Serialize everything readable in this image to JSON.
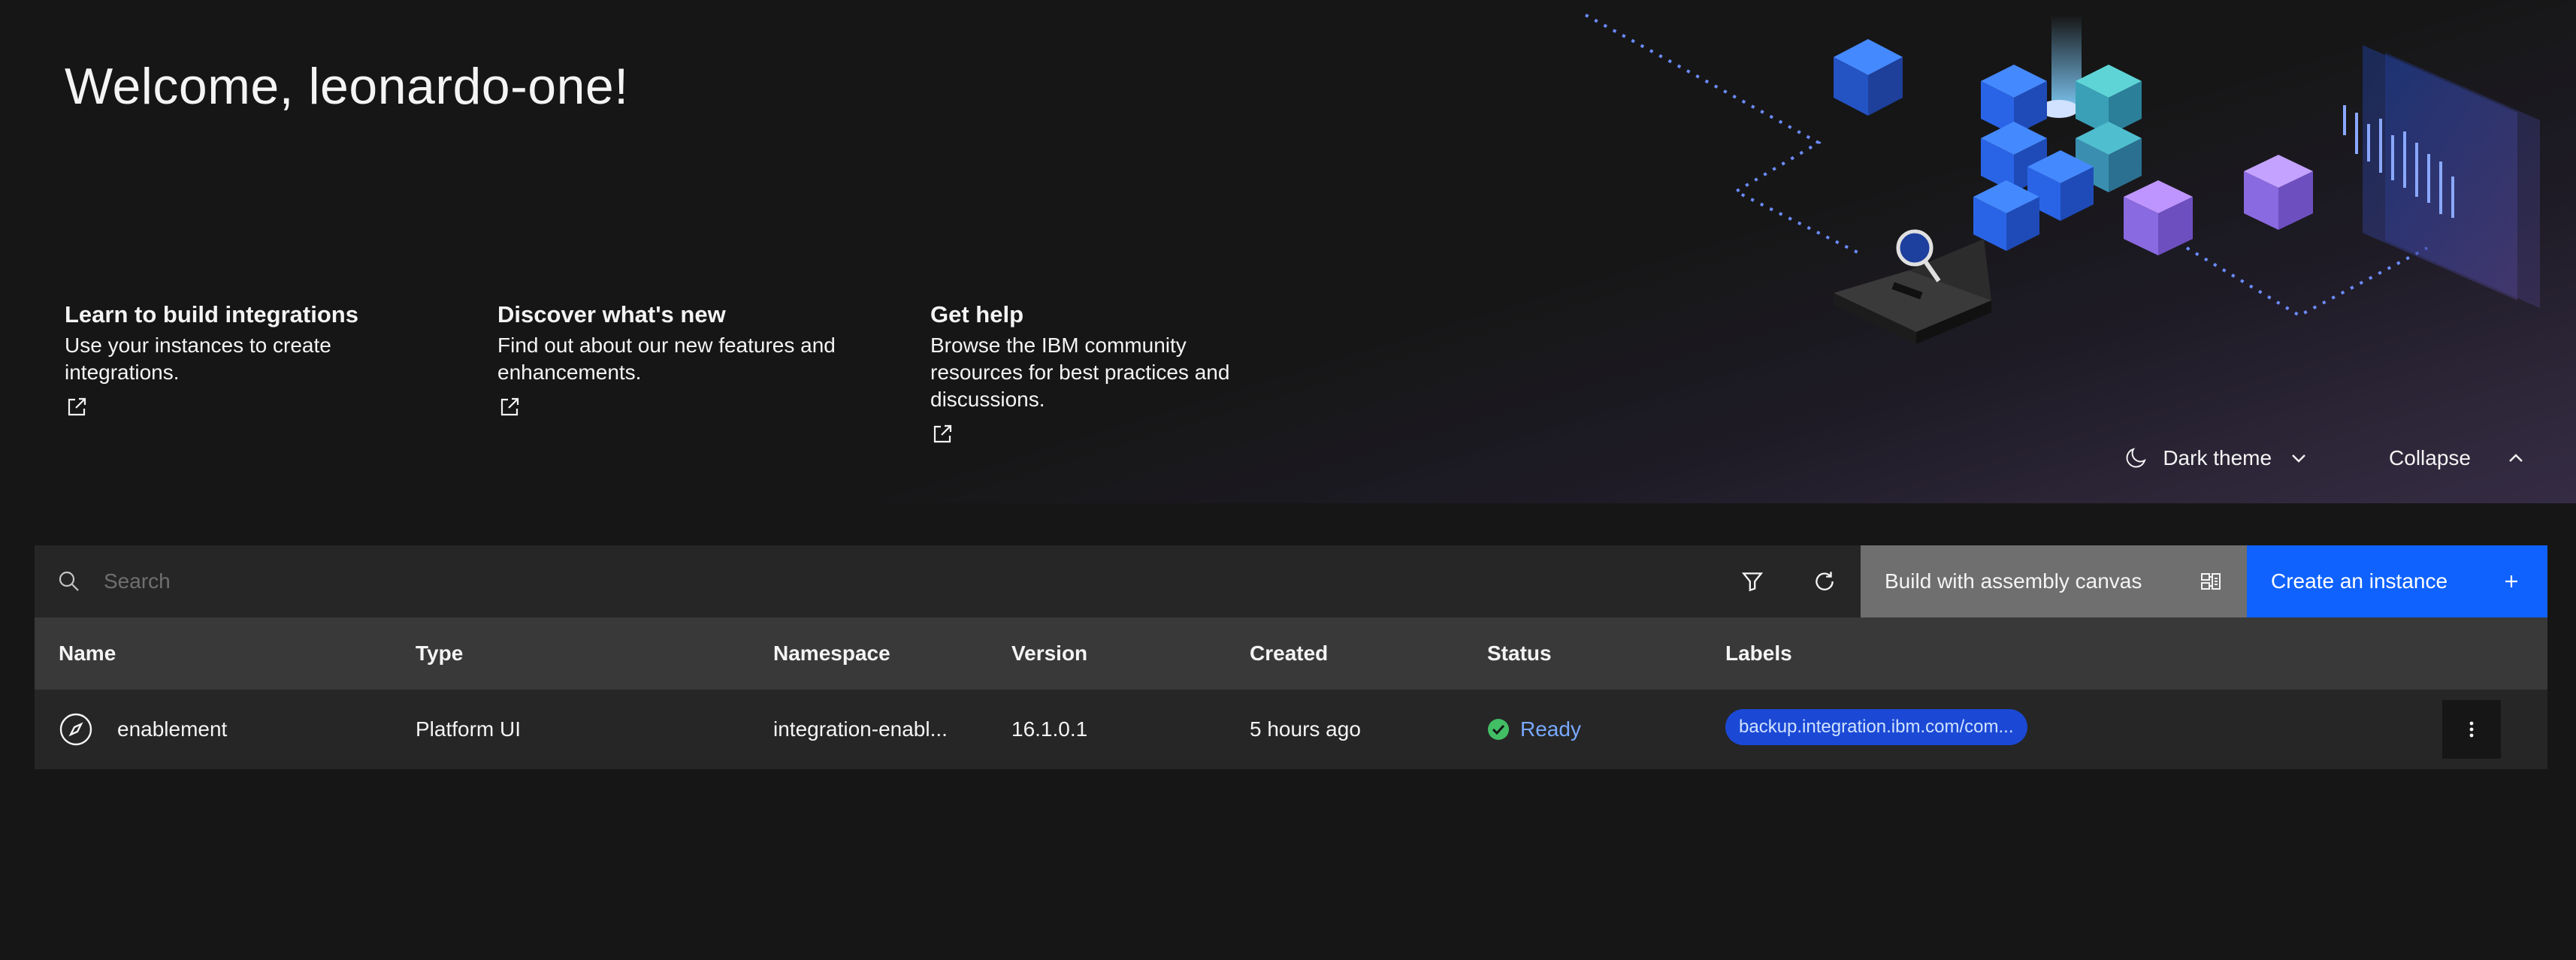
{
  "hero": {
    "welcome": "Welcome, leonardo-one!",
    "cards": [
      {
        "title": "Learn to build integrations",
        "description": "Use your instances to create integrations.",
        "link_icon": "launch-icon"
      },
      {
        "title": "Discover what's new",
        "description": "Find out about our new features and enhancements.",
        "link_icon": "launch-icon"
      },
      {
        "title": "Get help",
        "description": "Browse the IBM community resources for best practices and discussions.",
        "link_icon": "launch-icon"
      }
    ],
    "theme_label": "Dark theme",
    "collapse_label": "Collapse"
  },
  "toolbar": {
    "search_placeholder": "Search",
    "build_canvas_label": "Build with assembly canvas",
    "create_instance_label": "Create an instance"
  },
  "table": {
    "headers": [
      "Name",
      "Type",
      "Namespace",
      "Version",
      "Created",
      "Status",
      "Labels"
    ],
    "rows": [
      {
        "name": "enablement",
        "type": "Platform UI",
        "namespace": "integration-enabl...",
        "version": "16.1.0.1",
        "created": "5 hours ago",
        "status": "Ready",
        "label": "backup.integration.ibm.com/com..."
      }
    ]
  },
  "colors": {
    "background": "#161616",
    "accent": "#0f62fe",
    "status_ready": "#42be65",
    "status_text": "#78a9ff",
    "tag": "#1b49d6"
  }
}
